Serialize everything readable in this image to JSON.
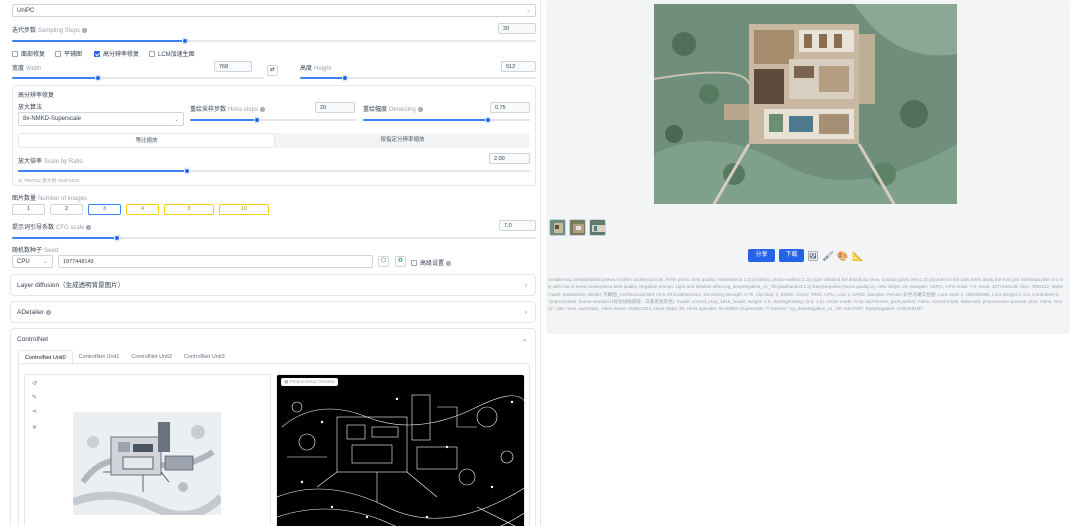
{
  "sampler": {
    "value": "UniPC"
  },
  "steps": {
    "label": "迭代步数",
    "sub": "Sampling Steps",
    "value": "20",
    "fraction": 0.33
  },
  "options": [
    {
      "label": "面部修复",
      "checked": false
    },
    {
      "label": "平铺图",
      "checked": false
    },
    {
      "label": "高分辨率修复",
      "checked": true
    },
    {
      "label": "LCM加速生图",
      "checked": false
    }
  ],
  "width": {
    "label": "宽度",
    "sub": "Width",
    "value": "768",
    "fraction": 0.34
  },
  "height": {
    "label": "高度",
    "sub": "Height",
    "value": "512",
    "fraction": 0.19
  },
  "swap_icon": "⇄",
  "hires": {
    "title": "高分辨率修复",
    "upscaler_label": "放大算法",
    "upscaler_value": "8x-NMKD-Superscale",
    "steps_label": "重绘采样步数",
    "steps_sub": "Hires steps",
    "steps_value": "20",
    "steps_fraction": 0.4,
    "denoise_label": "重绘幅度",
    "denoise_sub": "Denoising",
    "denoise_value": "0.75",
    "denoise_fraction": 0.75,
    "mode_a": "等比缩放",
    "mode_b": "按指定分辨率缩放",
    "scale_label": "放大倍率",
    "scale_sub": "Scale by Ratio",
    "scale_value": "2.00",
    "scale_fraction": 0.33,
    "size_hint": "从 768*512 放大到 1536*1024"
  },
  "batch": {
    "label": "图片数量",
    "sub": "Number of images",
    "options": [
      "1",
      "2",
      "3",
      "4",
      "8",
      "10"
    ],
    "selected": "3"
  },
  "cfg": {
    "label": "提示词引导系数",
    "sub": "CFG scale",
    "value": "7.0",
    "fraction": 0.2
  },
  "seed": {
    "label": "随机数种子",
    "sub": "Seed",
    "device": "CPU",
    "value": "1977448149",
    "dice_icon": "dice-icon",
    "recycle_icon": "recycle-icon",
    "advanced_label": "高级设置"
  },
  "accordions": {
    "layer": "Layer diffusion（生成透明背景图片）",
    "adetailer": "ADetailer",
    "controlnet": "ControlNet"
  },
  "cn_tabs": [
    "ControlNet Unit0",
    "ControlNet Unit1",
    "ControlNet Unit2",
    "ControlNet Unit3"
  ],
  "preview_label": "Preprocessor Preview",
  "actions": {
    "share": "分享",
    "download": "下载"
  },
  "params_text": "aerialtemap,aerialdetailed,anews,modern architecture,8k, RAW photo, best quality, masterpiece:1.2),(realistic, photo-realistic:1.3),super detailed,full detail],top view, outdoor,grass,tree:1.3),city,trees in the park,trees along the river,(an overhead plan of a city with lots of trees,masterpiece,best quality, Negative prompt: Light and shadow effect,ng_deepnegative_v1_75t,(badhandv4:1.2),EasyNegative,(worst quality:2), nsfw Steps: 20, Sampler: UniPC, CFG scale: 7.0, Seed: 1977448149, Size: 768x512, Model hash: 533a0c20e, Model: 鸟瞰图_Architectural MIX V0.5 V0.5.safetensors, Denoising strength: 0.75, Clip skip: 2, ENSD: 31337, RNG: CPU, Lora 1: SARD, Sampler: Render 彩色鸟瞰实拍图, Lora Hash 1: c825f2b08b, Lora Weight 1: 0.6, ControlNet 0: \"preprocessor: lineart standard (标准线稿提取 - 白底黑线反色), model: control_v11p_sd15_lineart, weight: 1.0, starting/ending: (0.0, 1.0), resize mode: Crop and Resize, pixel perfect: False, control mode: Balanced, preprocessor params: (512, None, None)\", vae: none, automatic, Hires resize: 1536x1024, Hires steps: 20, Hires upscaler: 8x-NMKD-Superscale, TI hashes: \"ng_deepnegative_v1_75t: 54e7e6f7, EasyNegative: c74b4e810b\""
}
